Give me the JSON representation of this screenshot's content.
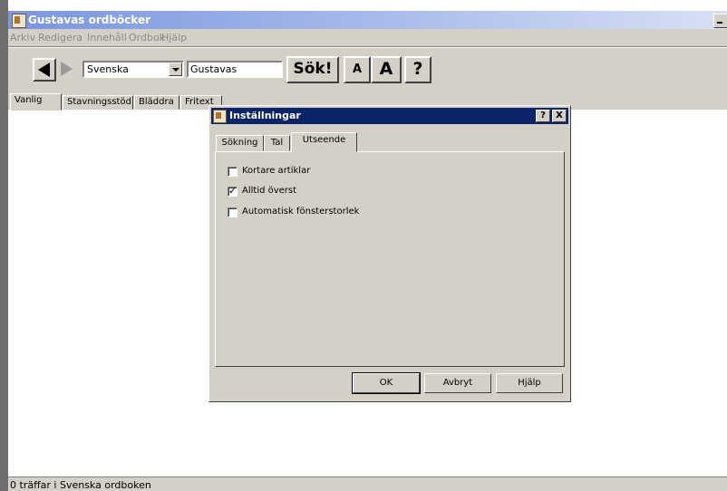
{
  "window": {
    "title": "Gustavas ordböcker"
  },
  "menu": [
    "Arkiv",
    "Redigera",
    "Innehåll",
    "Ordbok",
    "Hjälp"
  ],
  "toolbar": {
    "dictionary": "Svenska",
    "search_value": "Gustavas",
    "search_button": "Sök!",
    "font_small": "A",
    "font_large": "A",
    "help_button": "?"
  },
  "tabs": [
    "Vanlig",
    "Stavningsstöd",
    "Bläddra",
    "Fritext"
  ],
  "dialog": {
    "title": "Inställningar",
    "help_btn": "?",
    "close_btn": "X",
    "tabs": [
      "Sökning",
      "Tal",
      "Utseende"
    ],
    "options": [
      {
        "label": "Kortare artiklar",
        "checked": false
      },
      {
        "label": "Alltid överst",
        "checked": true
      },
      {
        "label": "Automatisk fönsterstorlek",
        "checked": false
      }
    ],
    "buttons": {
      "ok": "OK",
      "cancel": "Avbryt",
      "help": "Hjälp"
    }
  },
  "status": "0 träffar i Svenska ordboken"
}
